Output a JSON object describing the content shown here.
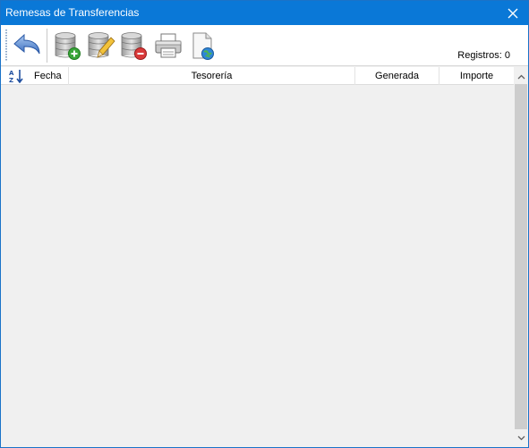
{
  "window": {
    "title": "Remesas de Transferencias",
    "accent_color": "#0a78d7"
  },
  "toolbar": {
    "buttons": [
      {
        "name": "back-button",
        "icon": "undo-arrow-icon"
      },
      {
        "name": "add-record-button",
        "icon": "database-add-icon"
      },
      {
        "name": "edit-record-button",
        "icon": "database-edit-icon"
      },
      {
        "name": "delete-record-button",
        "icon": "database-delete-icon"
      },
      {
        "name": "print-button",
        "icon": "printer-icon"
      },
      {
        "name": "export-web-button",
        "icon": "document-globe-icon"
      }
    ],
    "registros_label": "Registros: 0"
  },
  "grid": {
    "sort_icon": "sort-az-icon",
    "columns": [
      "Fecha",
      "Tesorería",
      "Generada",
      "Importe"
    ],
    "rows": []
  }
}
